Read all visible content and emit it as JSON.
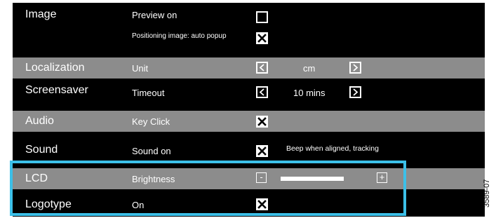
{
  "rows": [
    {
      "category": "Image",
      "setting": "Preview on",
      "checked": false
    },
    {
      "category": "",
      "setting": "Positioning image: auto popup",
      "checked": true
    },
    {
      "category": "Localization",
      "setting": "Unit",
      "value": "cm"
    },
    {
      "category": "Screensaver",
      "setting": "Timeout",
      "value": "10 mins"
    },
    {
      "category": "Audio",
      "setting": "Key Click",
      "checked": true
    },
    {
      "category": "Sound",
      "setting": "Sound on",
      "checked": true,
      "note": "Beep when aligned, tracking"
    },
    {
      "category": "LCD",
      "setting": "Brightness",
      "minus": "-",
      "plus": "+",
      "level": 0.6
    },
    {
      "category": "Logotype",
      "setting": "On",
      "checked": true
    }
  ],
  "icons": {
    "checkmark": "x-check-icon",
    "prev": "chevron-left-icon",
    "next": "chevron-right-icon"
  },
  "colors": {
    "background": "#000000",
    "gray_row": "#8c8c8c",
    "text": "#ffffff",
    "highlight": "#3cc0e8"
  },
  "figure_id": "3589-07"
}
